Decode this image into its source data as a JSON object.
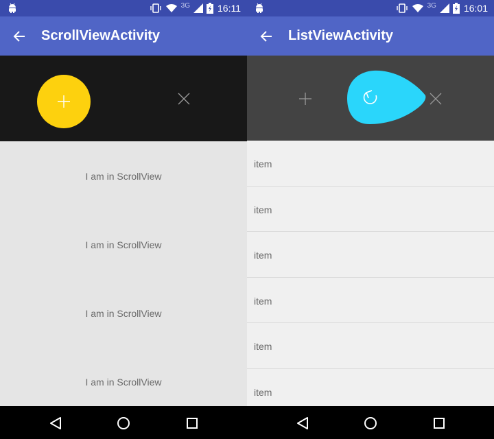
{
  "status_bar": {
    "left_time": "16:11",
    "right_time": "16:01",
    "network": "3G",
    "icons": [
      "android-icon",
      "vibrate-icon",
      "wifi-icon",
      "signal-icon",
      "battery-charging-icon"
    ]
  },
  "left_screen": {
    "title": "ScrollViewActivity",
    "back_icon": "arrow-back-icon",
    "header": {
      "fab_icon": "plus-icon",
      "close_icon": "close-icon"
    },
    "scroll_items": [
      "I am in ScrollView",
      "I am in ScrollView",
      "I am in ScrollView",
      "I am in ScrollView"
    ]
  },
  "right_screen": {
    "title": "ListViewActivity",
    "back_icon": "arrow-back-icon",
    "header": {
      "plus_icon": "plus-icon",
      "refresh_icon": "refresh-icon",
      "close_icon": "close-icon"
    },
    "list_items": [
      "item",
      "item",
      "item",
      "item",
      "item",
      "item"
    ]
  },
  "nav_bar": {
    "icons": [
      "nav-back-icon",
      "nav-home-icon",
      "nav-recents-icon"
    ]
  },
  "colors": {
    "status_bar": "#3a4bac",
    "app_bar": "#5065c6",
    "fab_yellow": "#fdd10e",
    "blob_cyan": "#2ad6fb",
    "header_dark": "#181818",
    "header_gray": "#434343"
  }
}
